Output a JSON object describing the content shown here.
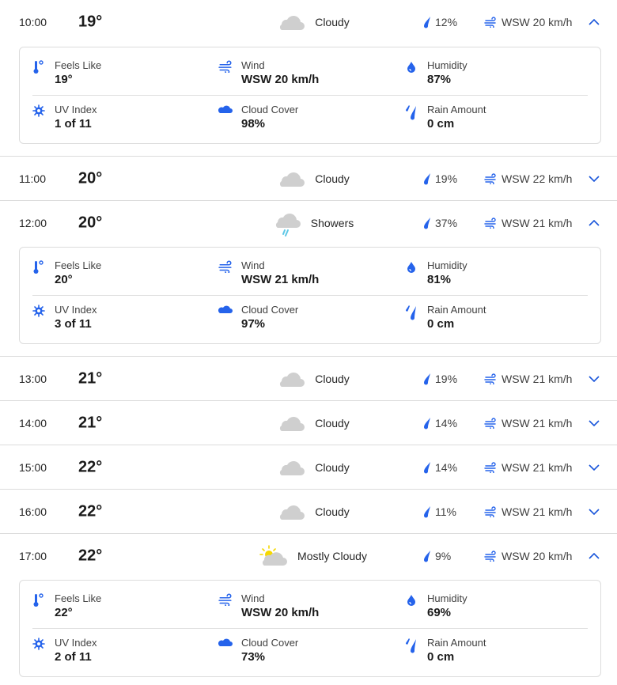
{
  "colors": {
    "accent": "#1a56db",
    "icon_blue": "#2563eb",
    "cloud_gray": "#cfcfcf",
    "rain_cyan": "#5ec8e6",
    "sun_yellow": "#f5d800",
    "divider": "#dcdcdc"
  },
  "labels": {
    "feels_like": "Feels Like",
    "wind": "Wind",
    "humidity": "Humidity",
    "uv_index": "UV Index",
    "cloud_cover": "Cloud Cover",
    "rain_amount": "Rain Amount"
  },
  "hours": [
    {
      "time": "10:00",
      "temp": "19°",
      "condition": "Cloudy",
      "condition_icon": "cloud-icon",
      "precip": "12%",
      "wind": "WSW 20 km/h",
      "expanded": true,
      "details": {
        "feels_like": "19°",
        "wind": "WSW 20 km/h",
        "humidity": "87%",
        "uv_index": "1 of 11",
        "cloud_cover": "98%",
        "rain_amount": "0 cm"
      }
    },
    {
      "time": "11:00",
      "temp": "20°",
      "condition": "Cloudy",
      "condition_icon": "cloud-icon",
      "precip": "19%",
      "wind": "WSW 22 km/h",
      "expanded": false
    },
    {
      "time": "12:00",
      "temp": "20°",
      "condition": "Showers",
      "condition_icon": "showers-icon",
      "precip": "37%",
      "wind": "WSW 21 km/h",
      "expanded": true,
      "details": {
        "feels_like": "20°",
        "wind": "WSW 21 km/h",
        "humidity": "81%",
        "uv_index": "3 of 11",
        "cloud_cover": "97%",
        "rain_amount": "0 cm"
      }
    },
    {
      "time": "13:00",
      "temp": "21°",
      "condition": "Cloudy",
      "condition_icon": "cloud-icon",
      "precip": "19%",
      "wind": "WSW 21 km/h",
      "expanded": false
    },
    {
      "time": "14:00",
      "temp": "21°",
      "condition": "Cloudy",
      "condition_icon": "cloud-icon",
      "precip": "14%",
      "wind": "WSW 21 km/h",
      "expanded": false
    },
    {
      "time": "15:00",
      "temp": "22°",
      "condition": "Cloudy",
      "condition_icon": "cloud-icon",
      "precip": "14%",
      "wind": "WSW 21 km/h",
      "expanded": false
    },
    {
      "time": "16:00",
      "temp": "22°",
      "condition": "Cloudy",
      "condition_icon": "cloud-icon",
      "precip": "11%",
      "wind": "WSW 21 km/h",
      "expanded": false
    },
    {
      "time": "17:00",
      "temp": "22°",
      "condition": "Mostly Cloudy",
      "condition_icon": "mostly-cloudy-icon",
      "precip": "9%",
      "wind": "WSW 20 km/h",
      "expanded": true,
      "details": {
        "feels_like": "22°",
        "wind": "WSW 20 km/h",
        "humidity": "69%",
        "uv_index": "2 of 11",
        "cloud_cover": "73%",
        "rain_amount": "0 cm"
      }
    }
  ]
}
